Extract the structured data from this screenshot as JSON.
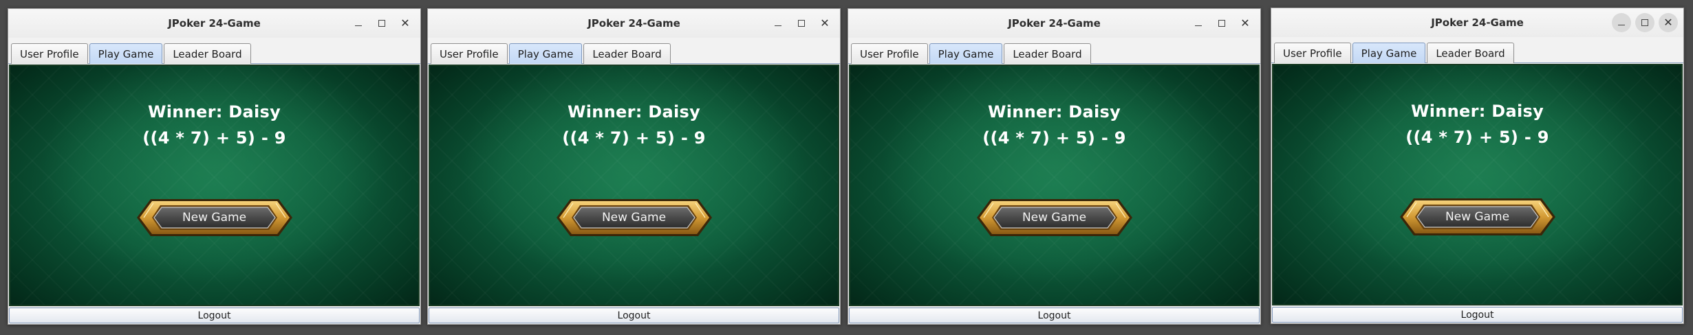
{
  "windows": [
    {
      "title": "JPoker 24-Game",
      "controls": [
        "minimize-icon",
        "maximize-icon",
        "close-icon"
      ],
      "tabs": [
        "User Profile",
        "Play Game",
        "Leader Board"
      ],
      "active_tab": "Play Game",
      "winner_text": "Winner: Daisy",
      "expression": "((4 * 7) + 5) - 9",
      "new_game_label": "New Game",
      "logout_label": "Logout"
    },
    {
      "title": "JPoker 24-Game",
      "controls": [
        "minimize-icon",
        "maximize-icon",
        "close-icon"
      ],
      "tabs": [
        "User Profile",
        "Play Game",
        "Leader Board"
      ],
      "active_tab": "Play Game",
      "winner_text": "Winner: Daisy",
      "expression": "((4 * 7) + 5) - 9",
      "new_game_label": "New Game",
      "logout_label": "Logout"
    },
    {
      "title": "JPoker 24-Game",
      "controls": [
        "minimize-icon",
        "maximize-icon",
        "close-icon"
      ],
      "tabs": [
        "User Profile",
        "Play Game",
        "Leader Board"
      ],
      "active_tab": "Play Game",
      "winner_text": "Winner: Daisy",
      "expression": "((4 * 7) + 5) - 9",
      "new_game_label": "New Game",
      "logout_label": "Logout"
    },
    {
      "title": "JPoker 24-Game",
      "controls": [
        "minimize-icon",
        "maximize-icon",
        "close-icon"
      ],
      "tabs": [
        "User Profile",
        "Play Game",
        "Leader Board"
      ],
      "active_tab": "Play Game",
      "winner_text": "Winner: Daisy",
      "expression": "((4 * 7) + 5) - 9",
      "new_game_label": "New Game",
      "logout_label": "Logout"
    }
  ],
  "colors": {
    "felt_green": "#0d5a3a",
    "active_tab_blue": "#c3d8f4",
    "button_gold": "#d9a13a",
    "button_face": "#4a4a4a"
  }
}
